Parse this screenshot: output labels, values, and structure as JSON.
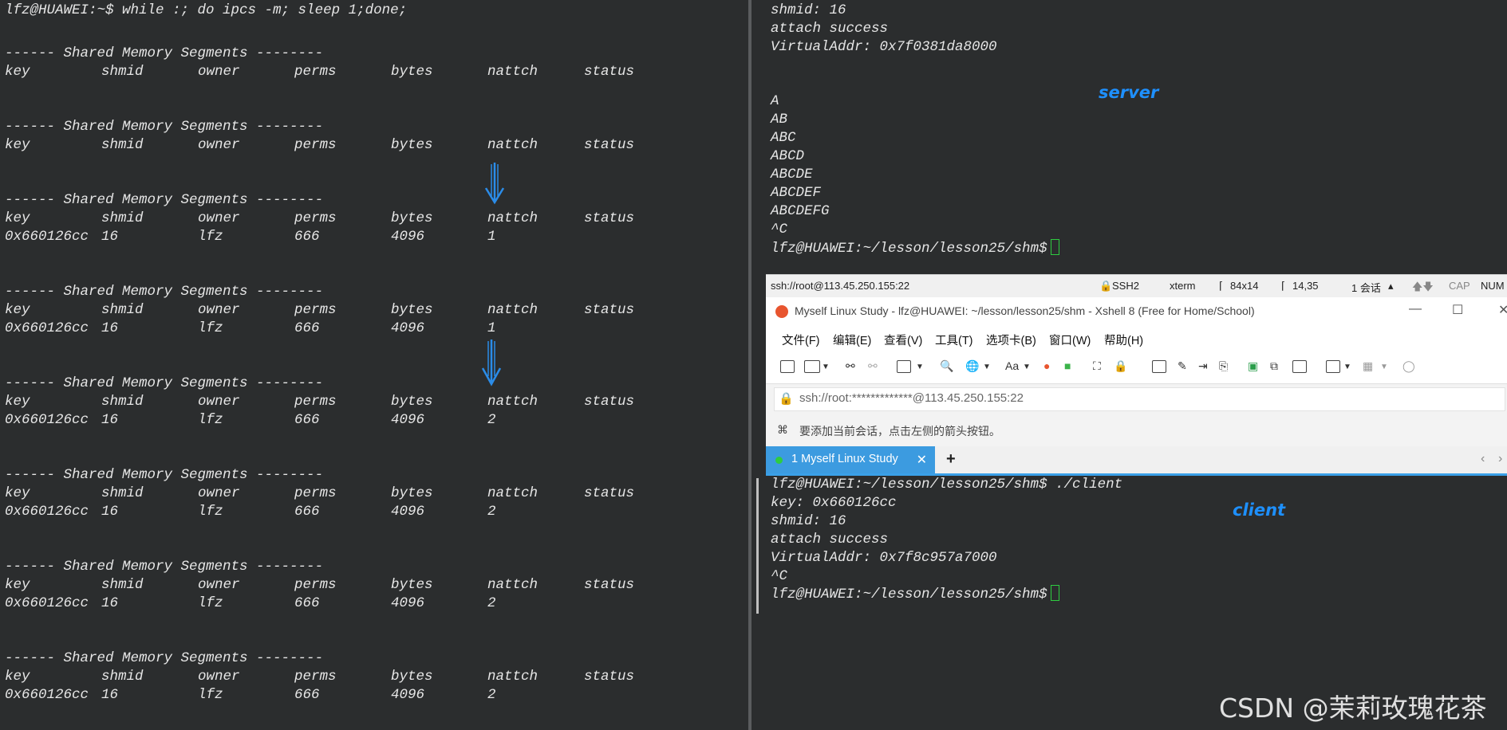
{
  "left_terminal": {
    "command": "lfz@HUAWEI:~$ while :; do ipcs -m; sleep 1;done;",
    "header_title": "------ Shared Memory Segments --------",
    "columns": [
      "key",
      "shmid",
      "owner",
      "perms",
      "bytes",
      "nattch",
      "status"
    ],
    "blocks": [
      {
        "row": null
      },
      {
        "row": null
      },
      {
        "row": [
          "0x660126cc",
          "16",
          "lfz",
          "666",
          "4096",
          "1",
          ""
        ]
      },
      {
        "row": [
          "0x660126cc",
          "16",
          "lfz",
          "666",
          "4096",
          "1",
          ""
        ]
      },
      {
        "row": [
          "0x660126cc",
          "16",
          "lfz",
          "666",
          "4096",
          "2",
          ""
        ]
      },
      {
        "row": [
          "0x660126cc",
          "16",
          "lfz",
          "666",
          "4096",
          "2",
          ""
        ]
      },
      {
        "row": [
          "0x660126cc",
          "16",
          "lfz",
          "666",
          "4096",
          "2",
          ""
        ]
      },
      {
        "row": [
          "0x660126cc",
          "16",
          "lfz",
          "666",
          "4096",
          "2",
          ""
        ]
      }
    ]
  },
  "server_terminal": {
    "label": "server",
    "lines_top": [
      "shmid: 16",
      "attach success",
      "VirtualAddr: 0x7f0381da8000"
    ],
    "lines_output": [
      "A",
      "AB",
      "ABC",
      "ABCD",
      "ABCDE",
      "ABCDEF",
      "ABCDEFG",
      "^C"
    ],
    "prompt": "lfz@HUAWEI:~/lesson/lesson25/shm$"
  },
  "status_bar": {
    "connection": "ssh://root@113.45.250.155:22",
    "protocol": "SSH2",
    "terminal_type": "xterm",
    "size": "84x14",
    "position": "14,35",
    "sessions": "1 会话",
    "cap": "CAP",
    "num": "NUM"
  },
  "xshell": {
    "title": "Myself Linux Study - lfz@HUAWEI: ~/lesson/lesson25/shm - Xshell 8 (Free for Home/School)",
    "menu": [
      "文件(F)",
      "编辑(E)",
      "查看(V)",
      "工具(T)",
      "选项卡(B)",
      "窗口(W)",
      "帮助(H)"
    ],
    "font_button": "Aa",
    "address": "ssh://root:*************@113.45.250.155:22",
    "hint": "要添加当前会话，点击左侧的箭头按钮。",
    "tab_label": "1 Myself Linux Study",
    "add_tab": "+"
  },
  "client_terminal": {
    "label": "client",
    "lines": [
      "lfz@HUAWEI:~/lesson/lesson25/shm$ ./client",
      "key: 0x660126cc",
      "shmid: 16",
      "attach success",
      "VirtualAddr: 0x7f8c957a7000",
      "^C"
    ],
    "prompt": "lfz@HUAWEI:~/lesson/lesson25/shm$"
  },
  "watermark": "CSDN @茉莉玫瑰花茶",
  "colors": {
    "terminal_bg": "#2b2d2e",
    "label_blue": "#1e90ff",
    "cursor_green": "#2ecc40",
    "tab_blue": "#3c9be0"
  }
}
